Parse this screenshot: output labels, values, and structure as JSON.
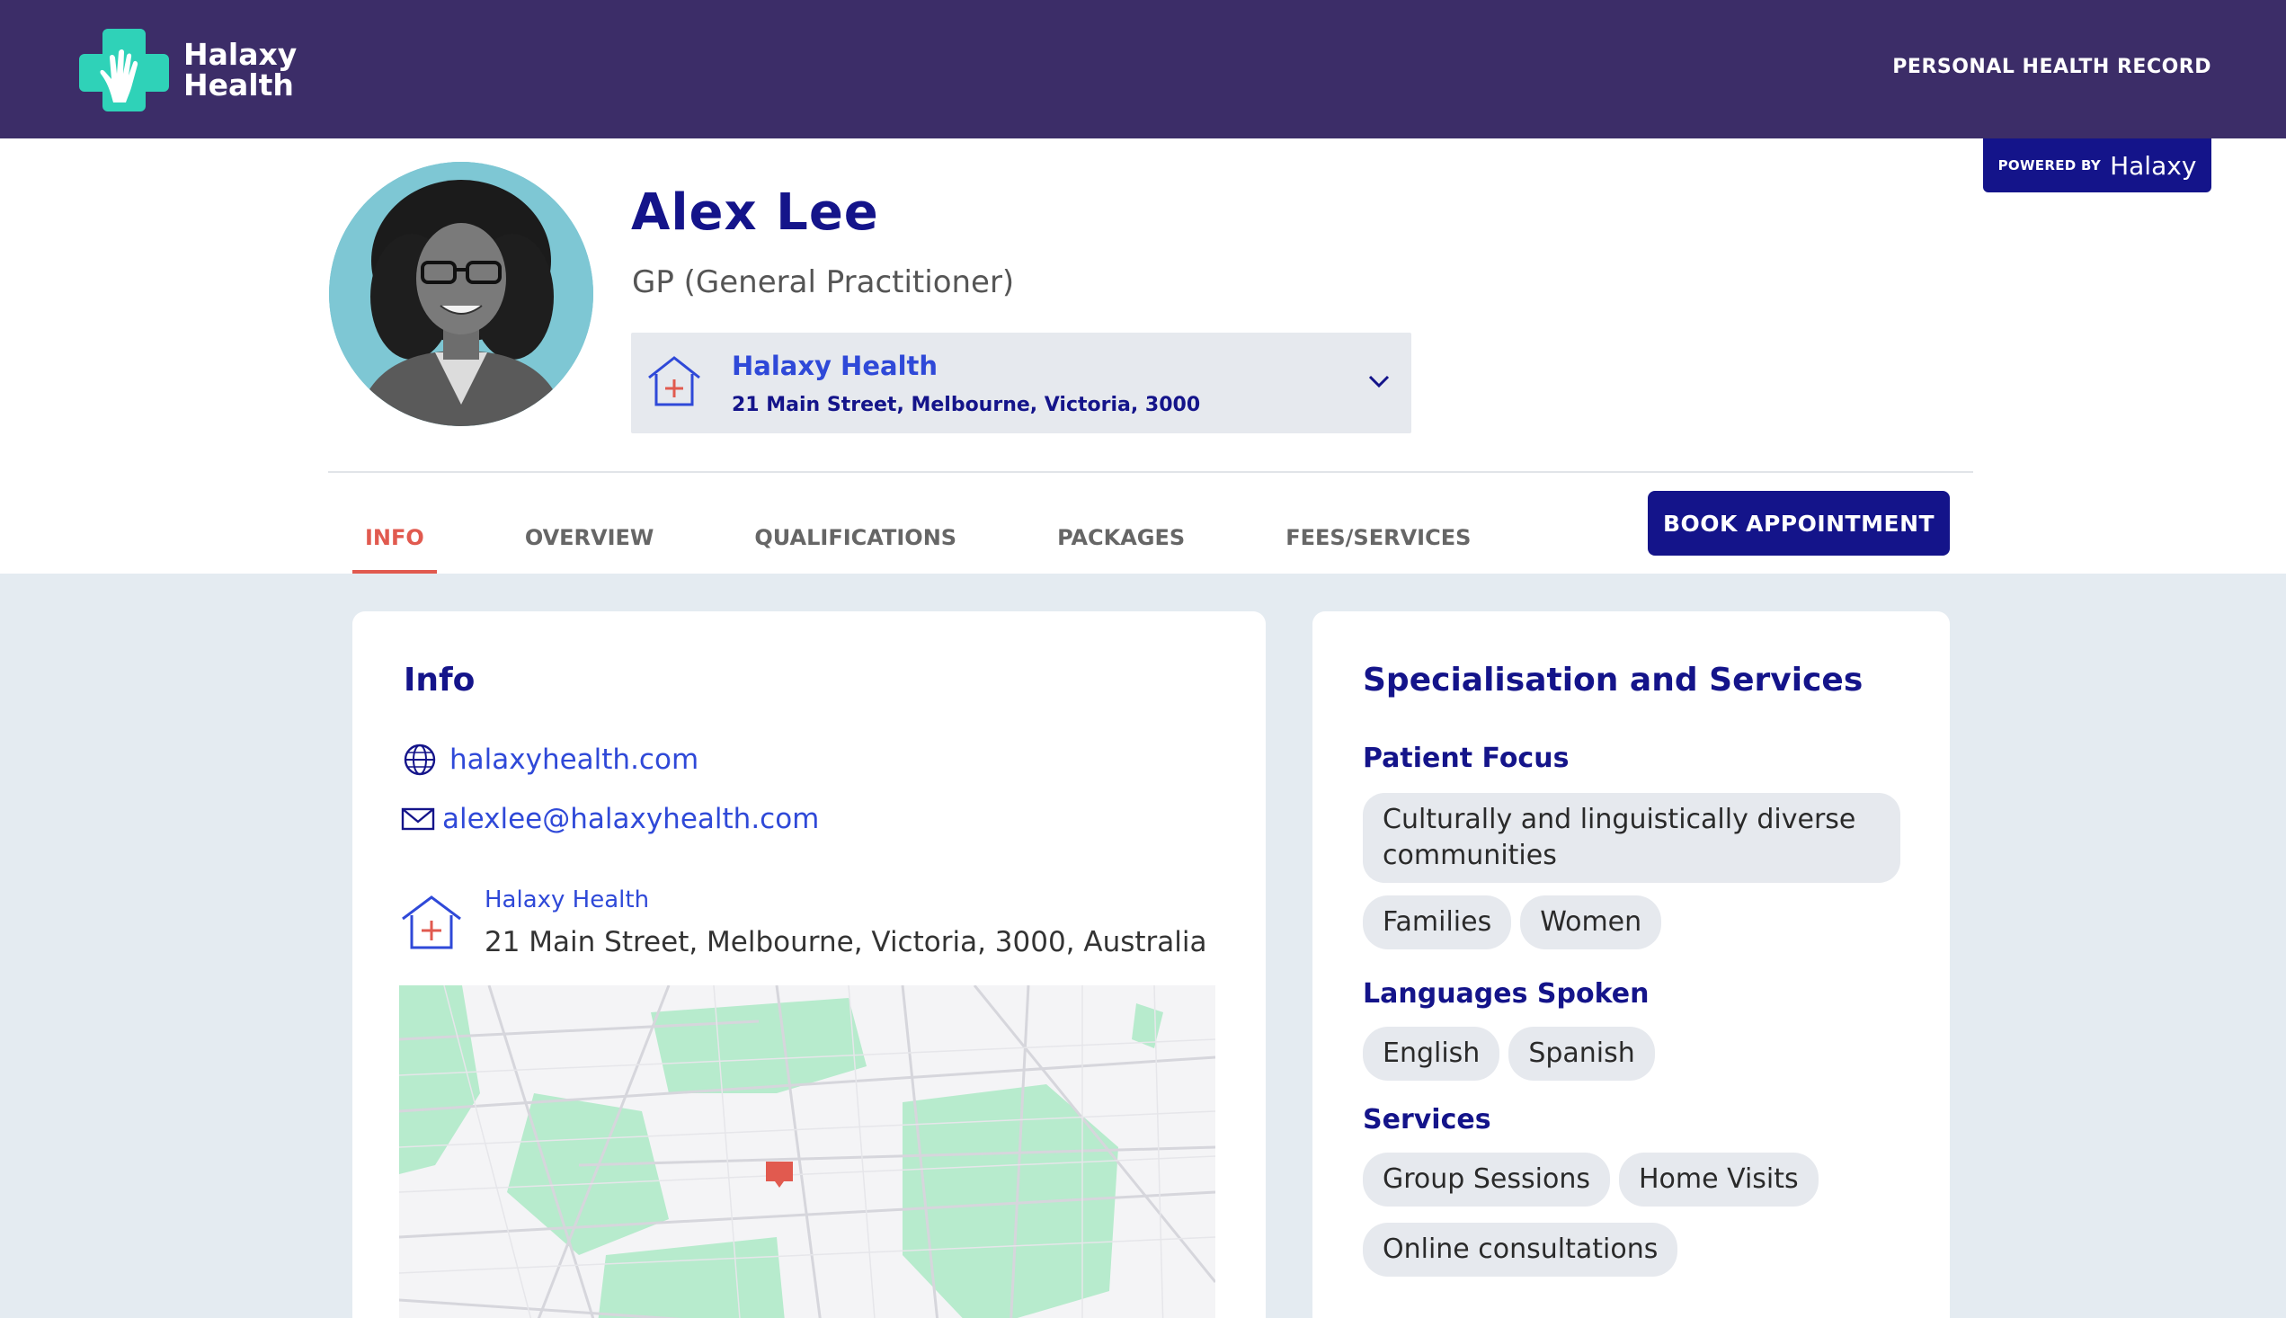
{
  "header": {
    "brand_line1": "Halaxy",
    "brand_line2": "Health",
    "phr_link": "PERSONAL HEALTH RECORD"
  },
  "powered": {
    "by": "POWERED BY",
    "brand": "Halaxy"
  },
  "profile": {
    "name": "Alex Lee",
    "role": "GP (General Practitioner)",
    "location": {
      "name": "Halaxy Health",
      "address": "21 Main Street, Melbourne, Victoria, 3000"
    }
  },
  "tabs": [
    {
      "label": "INFO",
      "active": true
    },
    {
      "label": "OVERVIEW"
    },
    {
      "label": "QUALIFICATIONS"
    },
    {
      "label": "PACKAGES"
    },
    {
      "label": "FEES/SERVICES"
    }
  ],
  "book_button": "BOOK APPOINTMENT",
  "info": {
    "title": "Info",
    "website": "halaxyhealth.com",
    "email": "alexlee@halaxyhealth.com",
    "address_name": "Halaxy Health",
    "address_full": "21 Main Street, Melbourne, Victoria, 3000, Australia"
  },
  "spec": {
    "title": "Specialisation and Services",
    "patient_focus": {
      "heading": "Patient Focus",
      "items": [
        "Culturally and linguistically diverse communities",
        "Families",
        "Women"
      ]
    },
    "languages": {
      "heading": "Languages Spoken",
      "items": [
        "English",
        "Spanish"
      ]
    },
    "services": {
      "heading": "Services",
      "items": [
        "Group Sessions",
        "Home Visits",
        "Online consultations"
      ]
    }
  },
  "colors": {
    "header_bg": "#3c2d68",
    "brand_navy": "#14148a",
    "link_blue": "#2f49d8",
    "accent_red": "#e15a4f",
    "logo_teal": "#2fd2b8"
  }
}
